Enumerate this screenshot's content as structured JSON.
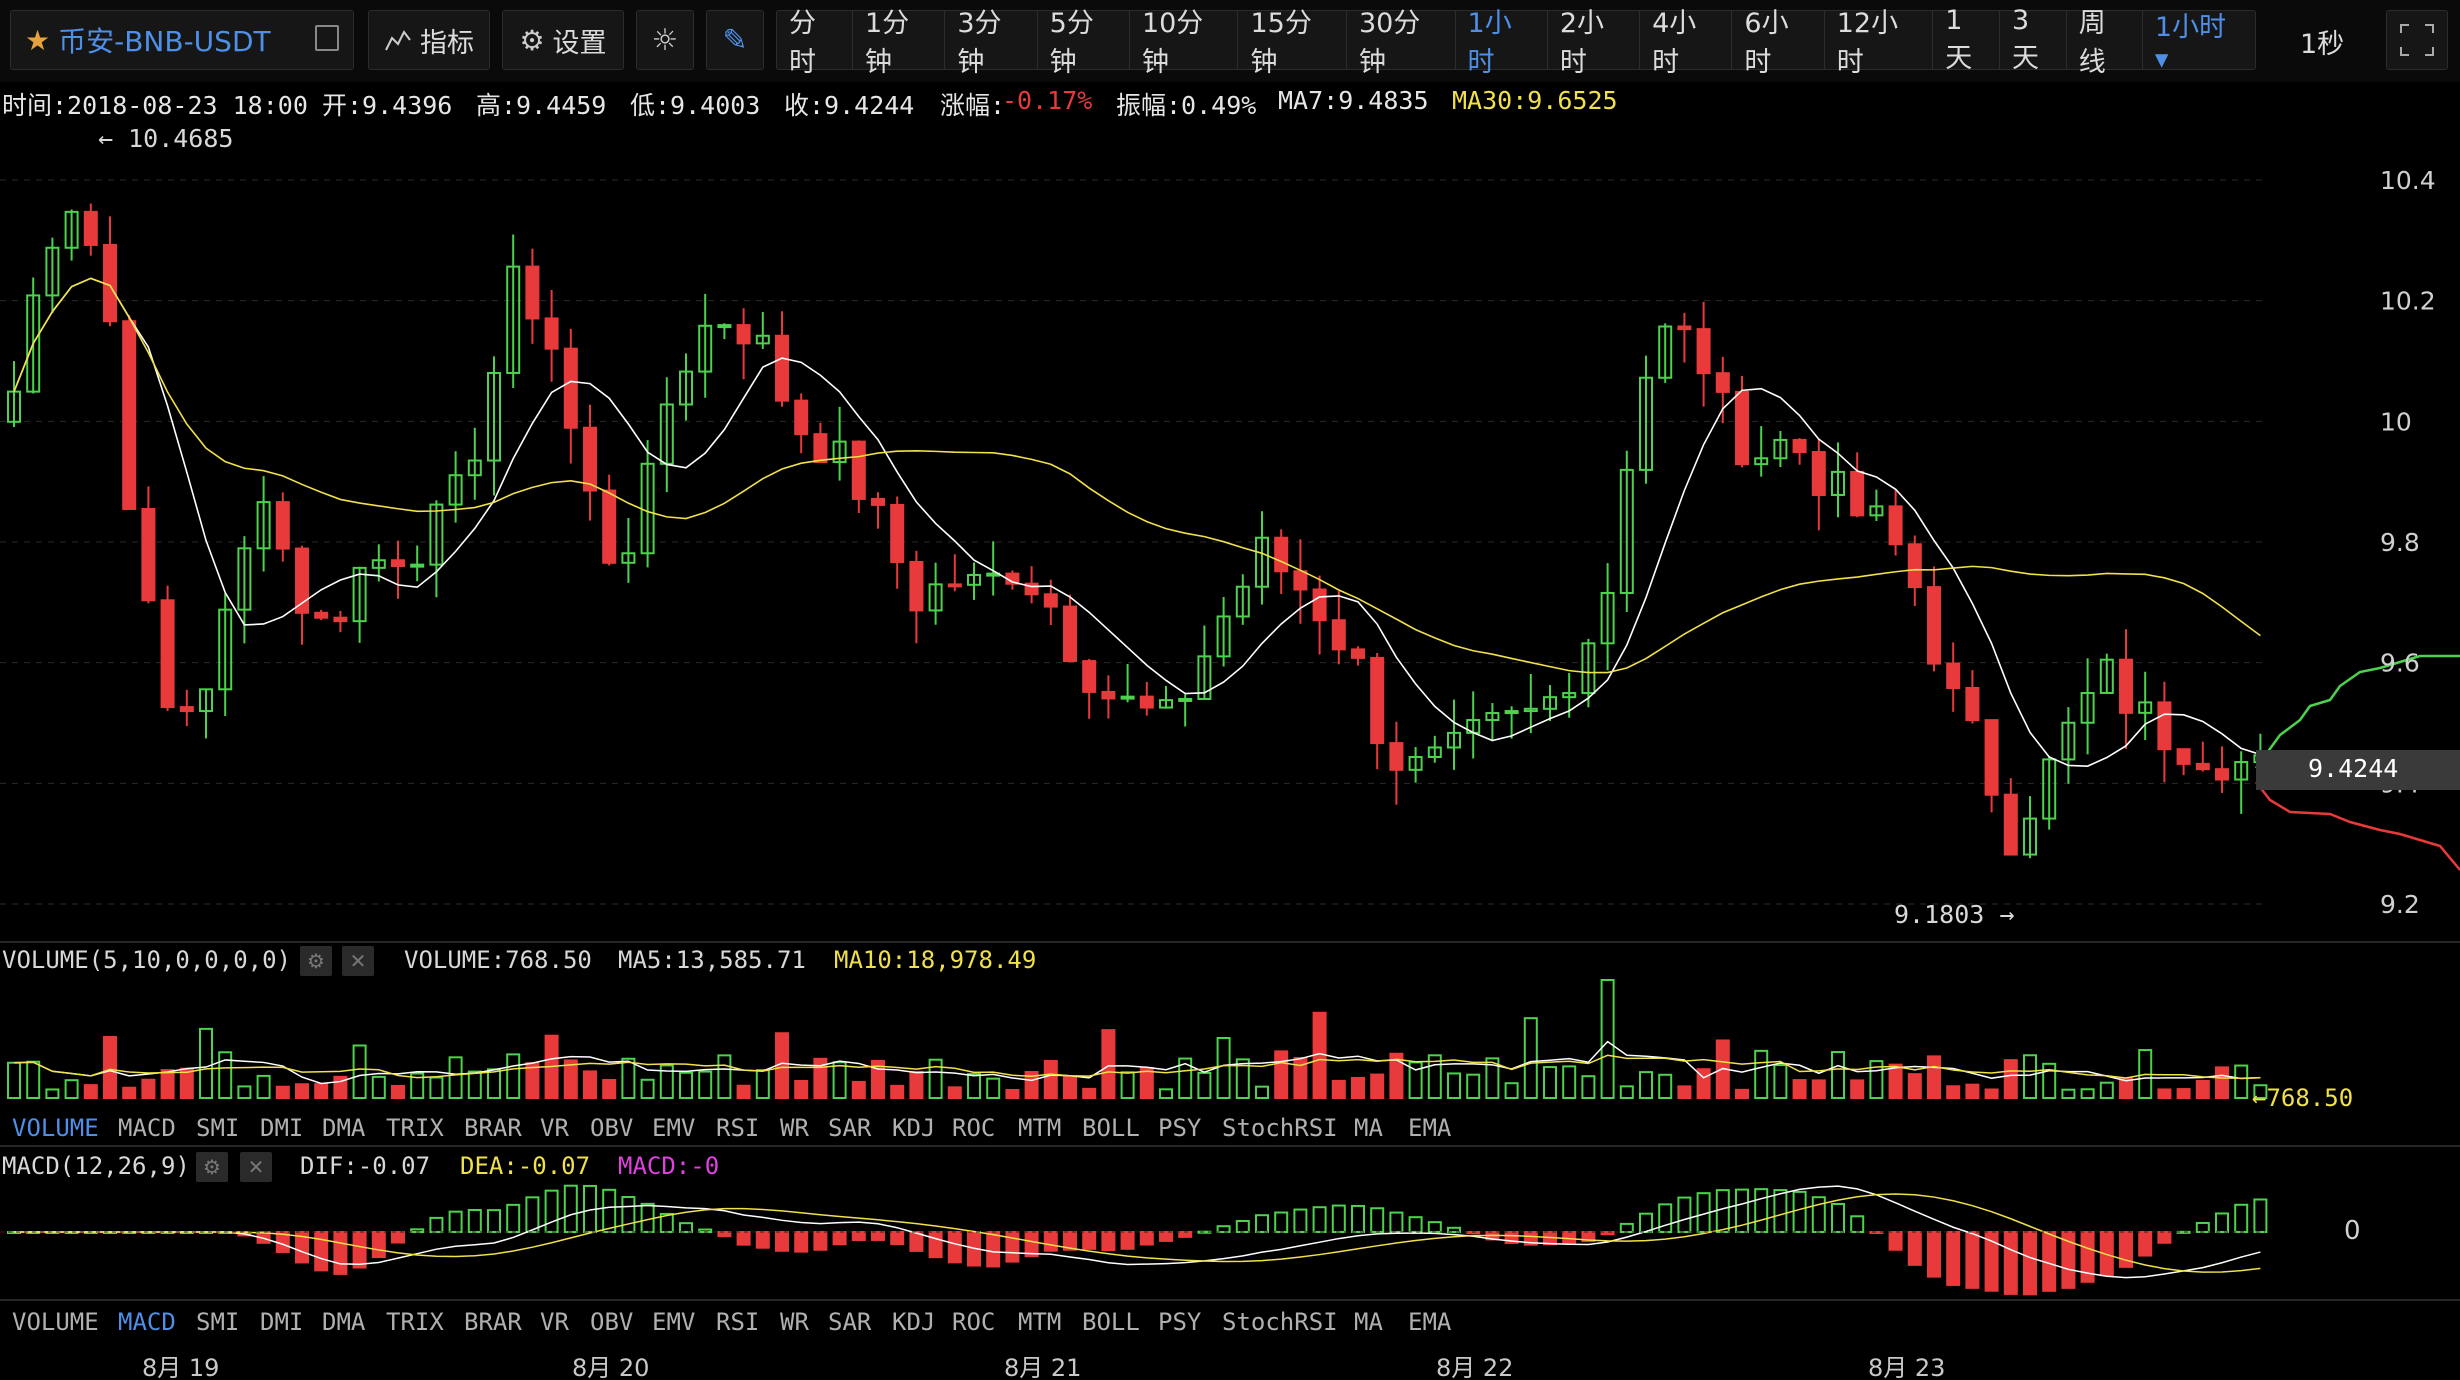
{
  "toolbar": {
    "pair_name": "币安-BNB-USDT",
    "indicator_label": "指标",
    "settings_label": "设置",
    "periods": [
      "分时",
      "1分钟",
      "3分钟",
      "5分钟",
      "10分钟",
      "15分钟",
      "30分钟",
      "1小时",
      "2小时",
      "4小时",
      "6小时",
      "12小时",
      "1天",
      "3天",
      "周线",
      "1小时 ▾"
    ],
    "active_period": "1小时",
    "refresh": "1秒"
  },
  "info": {
    "time": "时间:2018-08-23 18:00",
    "open": "开:9.4396",
    "high": "高:9.4459",
    "low": "低:9.4003",
    "close": "收:9.4244",
    "change_label": "涨幅:",
    "change_value": "-0.17%",
    "amplitude": "振幅:0.49%",
    "ma7": "MA7:9.4835",
    "ma30": "MA30:9.6525"
  },
  "price_axis": [
    "10.4",
    "10.2",
    "10",
    "9.8",
    "9.6",
    "9.4",
    "9.2"
  ],
  "current_price": "9.4244",
  "max_marker": "← 10.4685",
  "min_marker": "9.1803 →",
  "volume_panel": {
    "title": "VOLUME(5,10,0,0,0,0)",
    "volume": "VOLUME:768.50",
    "ma5": "MA5:13,585.71",
    "ma10": "MA10:18,978.49",
    "last_marker": "←768.50"
  },
  "macd_panel": {
    "title": "MACD(12,26,9)",
    "dif": "DIF:-0.07",
    "dea": "DEA:-0.07",
    "macd": "MACD:-0",
    "zero_label": "0"
  },
  "indicator_tabs": [
    "VOLUME",
    "MACD",
    "SMI",
    "DMI",
    "DMA",
    "TRIX",
    "BRAR",
    "VR",
    "OBV",
    "EMV",
    "RSI",
    "WR",
    "SAR",
    "KDJ",
    "ROC",
    "MTM",
    "BOLL",
    "PSY",
    "StochRSI",
    "MA",
    "EMA"
  ],
  "active_tab_1": "VOLUME",
  "active_tab_2": "MACD",
  "date_axis": [
    "8月 19",
    "8月 20",
    "8月 21",
    "8月 22",
    "8月 23"
  ],
  "colors": {
    "up": "#4cd24c",
    "down": "#e83a3a",
    "ma7": "#ffffff",
    "ma30": "#f0e04a",
    "accent": "#4e8fe8"
  }
}
